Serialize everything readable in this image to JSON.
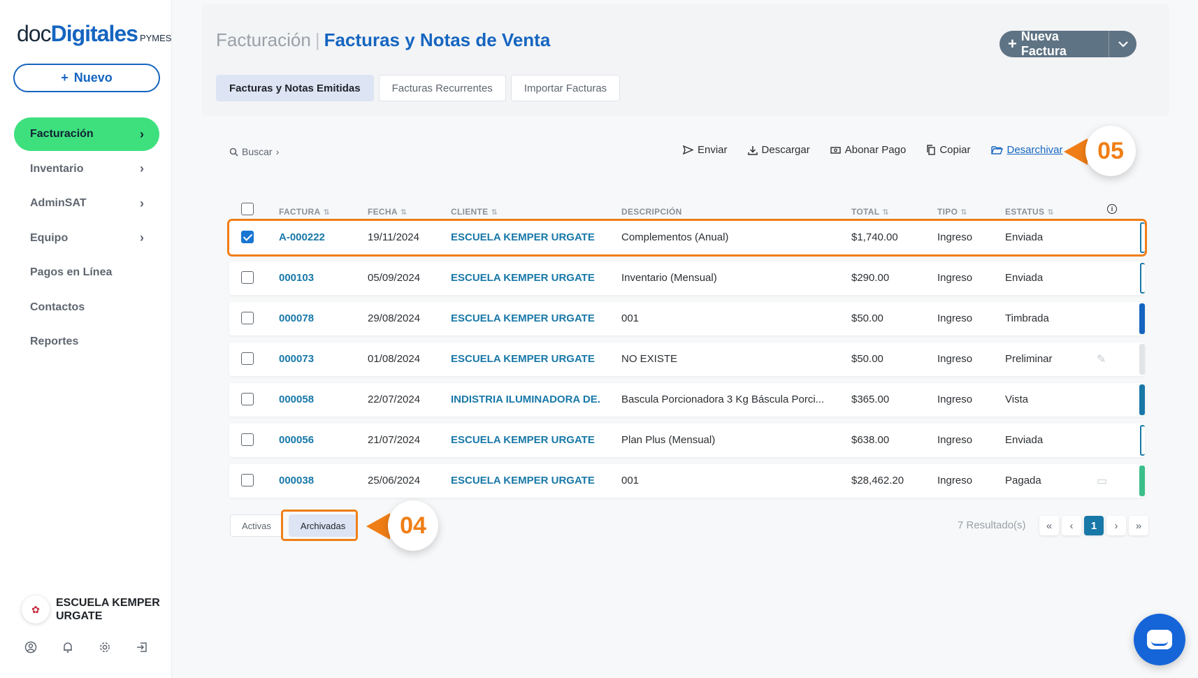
{
  "brand": {
    "part1": "doc",
    "part2": "Digitales",
    "part3": "PYMES"
  },
  "sidebar": {
    "new_button": "Nuevo",
    "items": [
      {
        "label": "Facturación",
        "active": true,
        "chevron": true
      },
      {
        "label": "Inventario",
        "active": false,
        "chevron": true
      },
      {
        "label": "AdminSAT",
        "active": false,
        "chevron": true
      },
      {
        "label": "Equipo",
        "active": false,
        "chevron": true
      },
      {
        "label": "Pagos en Línea",
        "active": false,
        "chevron": false
      },
      {
        "label": "Contactos",
        "active": false,
        "chevron": false
      },
      {
        "label": "Reportes",
        "active": false,
        "chevron": false
      }
    ],
    "org_name": "ESCUELA KEMPER URGATE",
    "bottom_icons": [
      "user-circle-icon",
      "bell-icon",
      "gear-icon",
      "logout-icon"
    ]
  },
  "header": {
    "breadcrumb": "Facturación",
    "separator": "|",
    "title": "Facturas y Notas de Venta",
    "new_invoice_label": "Nueva Factura"
  },
  "tabs": [
    {
      "label": "Facturas y Notas Emitidas",
      "active": true
    },
    {
      "label": "Facturas Recurrentes",
      "active": false
    },
    {
      "label": "Importar Facturas",
      "active": false
    }
  ],
  "toolbar": {
    "search_label": "Buscar",
    "actions": [
      {
        "label": "Enviar",
        "icon": "send-icon"
      },
      {
        "label": "Descargar",
        "icon": "download-icon"
      },
      {
        "label": "Abonar Pago",
        "icon": "payment-icon"
      },
      {
        "label": "Copiar",
        "icon": "copy-icon"
      },
      {
        "label": "Desarchivar",
        "icon": "folder-open-icon"
      }
    ]
  },
  "callouts": {
    "top": "05",
    "bottom": "04"
  },
  "table": {
    "columns": [
      "FACTURA",
      "FECHA",
      "CLIENTE",
      "DESCRIPCIÓN",
      "TOTAL",
      "TIPO",
      "ESTATUS"
    ],
    "rows": [
      {
        "factura": "A-000222",
        "fecha": "19/11/2024",
        "cliente": "ESCUELA KEMPER URGATE",
        "descripcion": "Complementos (Anual)",
        "total": "$1,740.00",
        "tipo": "Ingreso",
        "estatus": "Enviada",
        "checked": true,
        "bar": "outline"
      },
      {
        "factura": "000103",
        "fecha": "05/09/2024",
        "cliente": "ESCUELA KEMPER URGATE",
        "descripcion": "Inventario (Mensual)",
        "total": "$290.00",
        "tipo": "Ingreso",
        "estatus": "Enviada",
        "checked": false,
        "bar": "outline"
      },
      {
        "factura": "000078",
        "fecha": "29/08/2024",
        "cliente": "ESCUELA KEMPER URGATE",
        "descripcion": "001",
        "total": "$50.00",
        "tipo": "Ingreso",
        "estatus": "Timbrada",
        "checked": false,
        "bar": "#1565c0"
      },
      {
        "factura": "000073",
        "fecha": "01/08/2024",
        "cliente": "ESCUELA KEMPER URGATE",
        "descripcion": "NO EXISTE",
        "total": "$50.00",
        "tipo": "Ingreso",
        "estatus": "Preliminar",
        "checked": false,
        "bar": "#e2e5e8",
        "icon": "pencil-icon"
      },
      {
        "factura": "000058",
        "fecha": "22/07/2024",
        "cliente": "INDISTRIA ILUMINADORA DE...",
        "descripcion": "Bascula Porcionadora 3 Kg Báscula Porci...",
        "total": "$365.00",
        "tipo": "Ingreso",
        "estatus": "Vista",
        "checked": false,
        "bar": "#1878a8"
      },
      {
        "factura": "000056",
        "fecha": "21/07/2024",
        "cliente": "ESCUELA KEMPER URGATE",
        "descripcion": "Plan Plus (Mensual)",
        "total": "$638.00",
        "tipo": "Ingreso",
        "estatus": "Enviada",
        "checked": false,
        "bar": "outline"
      },
      {
        "factura": "000038",
        "fecha": "25/06/2024",
        "cliente": "ESCUELA KEMPER URGATE",
        "descripcion": "001",
        "total": "$28,462.20",
        "tipo": "Ingreso",
        "estatus": "Pagada",
        "checked": false,
        "bar": "#3bbf8a",
        "icon": "cash-icon"
      }
    ]
  },
  "footer": {
    "filters": [
      {
        "label": "Activas",
        "active": false
      },
      {
        "label": "Archivadas",
        "active": true
      }
    ],
    "results": "7 Resultado(s)",
    "current_page": "1"
  },
  "colors": {
    "accent": "#1565c0",
    "active_nav": "#3ee07e",
    "callout": "#f07e16"
  }
}
